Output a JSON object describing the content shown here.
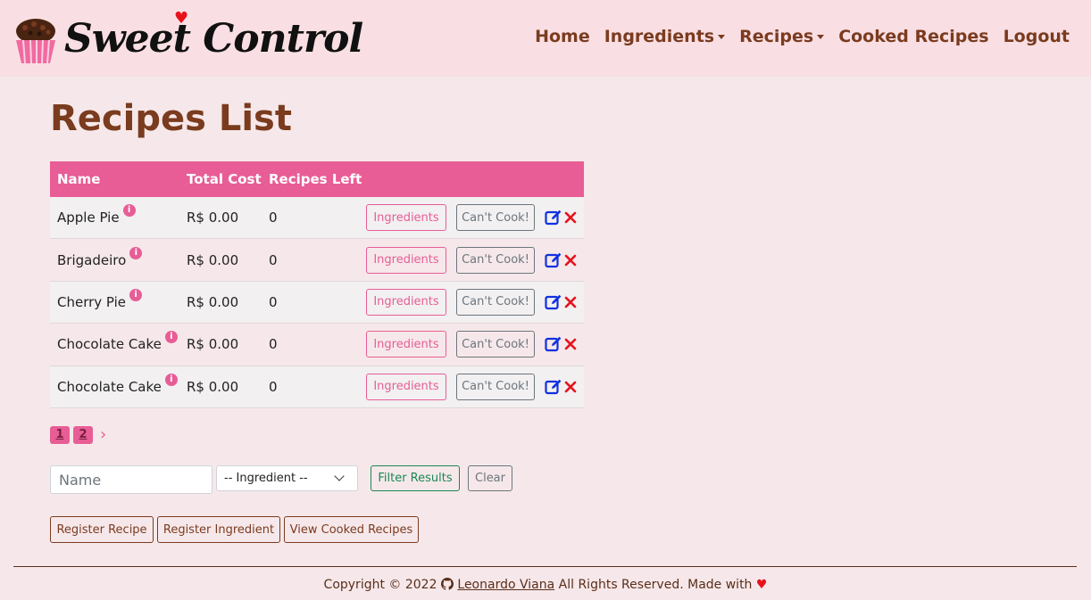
{
  "brand": {
    "name": "Sweet Control"
  },
  "nav": {
    "home": "Home",
    "ingredients": "Ingredients",
    "recipes": "Recipes",
    "cooked_recipes": "Cooked Recipes",
    "logout": "Logout"
  },
  "page": {
    "title": "Recipes List"
  },
  "table": {
    "headers": {
      "name": "Name",
      "total_cost": "Total Cost",
      "recipes_left": "Recipes Left"
    },
    "rows": [
      {
        "name": "Apple Pie",
        "total_cost": "R$ 0.00",
        "recipes_left": "0",
        "ingredients_btn": "Ingredients",
        "cook_btn": "Can't Cook!"
      },
      {
        "name": "Brigadeiro",
        "total_cost": "R$ 0.00",
        "recipes_left": "0",
        "ingredients_btn": "Ingredients",
        "cook_btn": "Can't Cook!"
      },
      {
        "name": "Cherry Pie",
        "total_cost": "R$ 0.00",
        "recipes_left": "0",
        "ingredients_btn": "Ingredients",
        "cook_btn": "Can't Cook!"
      },
      {
        "name": "Chocolate Cake",
        "total_cost": "R$ 0.00",
        "recipes_left": "0",
        "ingredients_btn": "Ingredients",
        "cook_btn": "Can't Cook!"
      },
      {
        "name": "Chocolate Cake",
        "total_cost": "R$ 0.00",
        "recipes_left": "0",
        "ingredients_btn": "Ingredients",
        "cook_btn": "Can't Cook!"
      }
    ]
  },
  "pagination": {
    "pages": [
      "1",
      "2"
    ],
    "next": "›"
  },
  "filters": {
    "name_placeholder": "Name",
    "ingredient_selected": "-- Ingredient --",
    "filter_label": "Filter Results",
    "clear_label": "Clear"
  },
  "actions": {
    "register_recipe": "Register Recipe",
    "register_ingredient": "Register Ingredient",
    "view_cooked": "View Cooked Recipes"
  },
  "footer": {
    "copyright": "Copyright © 2022",
    "author": "Leonardo Viana",
    "rights": "All Rights Reserved. Made with"
  },
  "colors": {
    "brand_brown": "#7a3b1f",
    "pink": "#e85d96",
    "navbar_bg": "#f9dfe3",
    "page_bg": "#f6e8ea"
  }
}
